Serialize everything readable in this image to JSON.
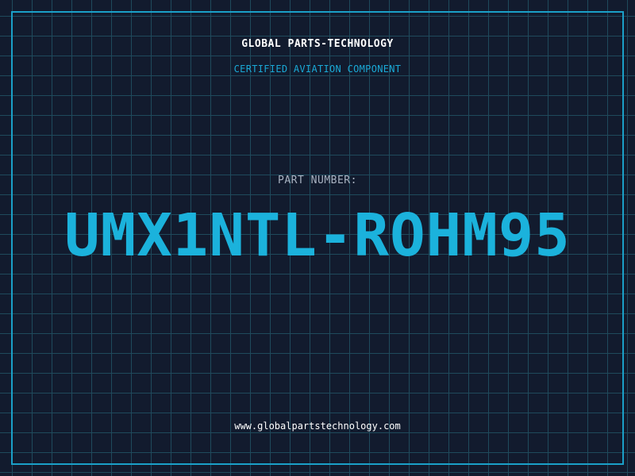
{
  "header": {
    "company": "GLOBAL PARTS-TECHNOLOGY",
    "subtitle": "CERTIFIED AVIATION COMPONENT"
  },
  "part": {
    "label": "PART NUMBER:",
    "number": "UMX1NTL-ROHM95"
  },
  "footer": {
    "url": "www.globalpartstechnology.com"
  },
  "colors": {
    "background": "#121b2e",
    "grid": "#1f4a5c",
    "accent": "#1bb2dc",
    "text": "#ffffff",
    "muted": "#a9b3c2"
  }
}
